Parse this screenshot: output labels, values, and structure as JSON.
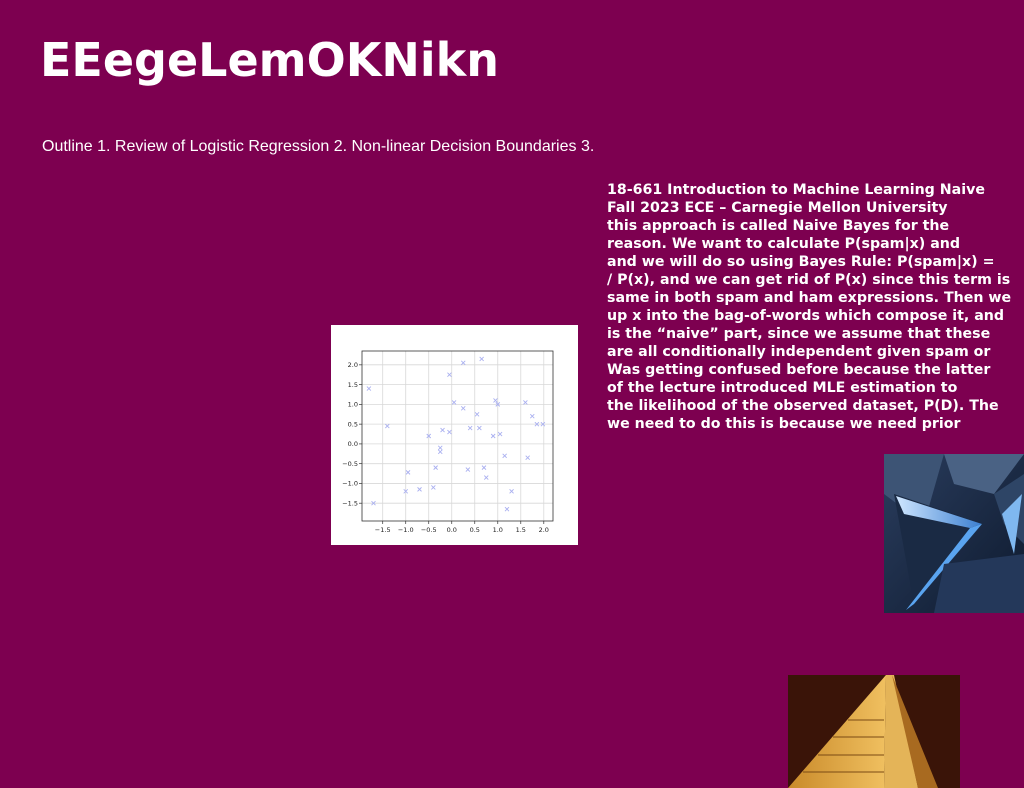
{
  "slide": {
    "title": "EEegeLemOKNikn",
    "outline": "Outline 1. Review of Logistic Regression 2. Non-linear Decision Boundaries 3.",
    "body_lines": [
      "18-661 Introduction to Machine Learning Naive",
      "Fall 2023 ECE – Carnegie Mellon University",
      "this approach is called Naive Bayes for the",
      "reason. We want to calculate P(spam|x) and",
      "and we will do so using Bayes Rule: P(spam|x) =",
      "/ P(x), and we can get rid of P(x) since this term is",
      "same in both spam and ham expressions. Then we",
      "up x into the bag-of-words which compose it, and",
      "is the “naive” part, since we assume that these",
      "are all conditionally independent given spam or",
      "Was getting confused before because the latter",
      "of the lecture introduced MLE estimation to",
      "the likelihood of the observed dataset, P(D). The",
      "we need to do this is because we need prior"
    ],
    "background_color": "#7d0050",
    "text_color": "#ffffff"
  },
  "chart_data": {
    "type": "scatter",
    "marker": "x",
    "marker_color": "#aab0f0",
    "grid": true,
    "xlim": [
      -1.95,
      2.2
    ],
    "ylim": [
      -1.95,
      2.35
    ],
    "xticks": [
      "−1.5",
      "−1.0",
      "−0.5",
      "0.0",
      "0.5",
      "1.0",
      "1.5",
      "2.0"
    ],
    "yticks": [
      "−1.5",
      "−1.0",
      "−0.5",
      "0.0",
      "0.5",
      "1.0",
      "1.5",
      "2.0"
    ],
    "xtick_values": [
      -1.5,
      -1.0,
      -0.5,
      0.0,
      0.5,
      1.0,
      1.5,
      2.0
    ],
    "ytick_values": [
      -1.5,
      -1.0,
      -0.5,
      0.0,
      0.5,
      1.0,
      1.5,
      2.0
    ],
    "points": [
      [
        -1.8,
        1.4
      ],
      [
        -1.7,
        -1.5
      ],
      [
        -1.4,
        0.45
      ],
      [
        -1.0,
        -1.2
      ],
      [
        -0.95,
        -0.72
      ],
      [
        -0.7,
        -1.15
      ],
      [
        -0.5,
        0.2
      ],
      [
        -0.4,
        -1.1
      ],
      [
        -0.35,
        -0.6
      ],
      [
        -0.25,
        -0.1
      ],
      [
        -0.25,
        -0.2
      ],
      [
        -0.2,
        0.35
      ],
      [
        -0.05,
        1.75
      ],
      [
        -0.05,
        0.3
      ],
      [
        0.05,
        1.05
      ],
      [
        0.25,
        2.05
      ],
      [
        0.25,
        0.9
      ],
      [
        0.35,
        -0.65
      ],
      [
        0.4,
        0.4
      ],
      [
        0.55,
        0.75
      ],
      [
        0.6,
        0.4
      ],
      [
        0.65,
        2.15
      ],
      [
        0.7,
        -0.6
      ],
      [
        0.75,
        -0.85
      ],
      [
        0.9,
        0.2
      ],
      [
        0.95,
        1.1
      ],
      [
        1.0,
        1.0
      ],
      [
        1.05,
        0.25
      ],
      [
        1.15,
        -0.3
      ],
      [
        1.2,
        -1.65
      ],
      [
        1.3,
        -1.2
      ],
      [
        1.6,
        1.05
      ],
      [
        1.65,
        -0.35
      ],
      [
        1.75,
        0.7
      ],
      [
        1.85,
        0.5
      ],
      [
        1.98,
        0.5
      ]
    ]
  }
}
